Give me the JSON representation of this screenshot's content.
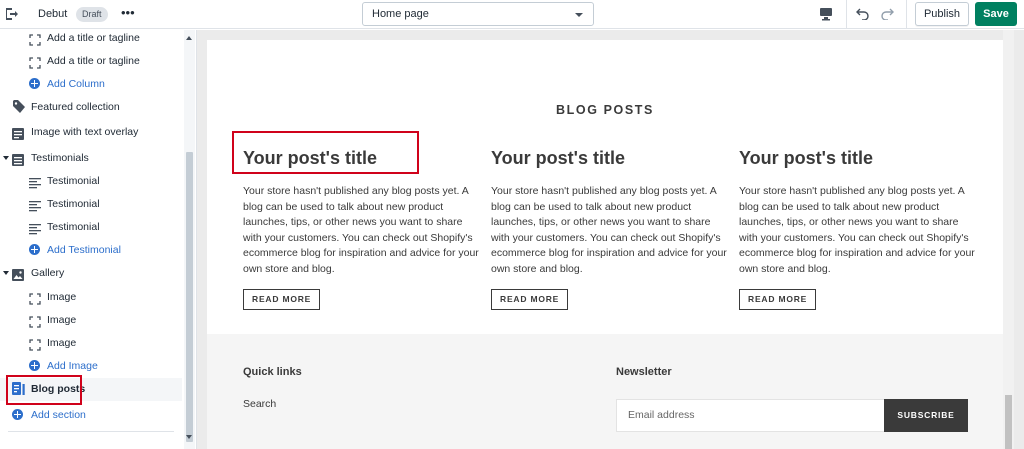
{
  "topbar": {
    "theme_name": "Debut",
    "status_badge": "Draft",
    "more_label": "•••",
    "page_select": "Home page",
    "publish_label": "Publish",
    "save_label": "Save"
  },
  "sidebar": {
    "items": [
      {
        "label": "Add a title or tagline",
        "kind": "block",
        "icon": "block-corners-icon"
      },
      {
        "label": "Add a title or tagline",
        "kind": "block",
        "icon": "block-corners-icon"
      },
      {
        "label": "Add Column",
        "kind": "add",
        "icon": "add-circle-icon"
      },
      {
        "label": "Featured collection",
        "kind": "section",
        "icon": "tag-icon"
      },
      {
        "label": "Image with text overlay",
        "kind": "section",
        "icon": "image-text-icon"
      },
      {
        "label": "Testimonials",
        "kind": "section-expanded",
        "icon": "list-icon"
      },
      {
        "label": "Testimonial",
        "kind": "block",
        "icon": "text-lines-icon"
      },
      {
        "label": "Testimonial",
        "kind": "block",
        "icon": "text-lines-icon"
      },
      {
        "label": "Testimonial",
        "kind": "block",
        "icon": "text-lines-icon"
      },
      {
        "label": "Add Testimonial",
        "kind": "add",
        "icon": "add-circle-icon"
      },
      {
        "label": "Gallery",
        "kind": "section-expanded",
        "icon": "image-icon"
      },
      {
        "label": "Image",
        "kind": "block",
        "icon": "block-corners-icon"
      },
      {
        "label": "Image",
        "kind": "block",
        "icon": "block-corners-icon"
      },
      {
        "label": "Image",
        "kind": "block",
        "icon": "block-corners-icon"
      },
      {
        "label": "Add Image",
        "kind": "add",
        "icon": "add-circle-icon"
      },
      {
        "label": "Blog posts",
        "kind": "section-active",
        "icon": "blog-icon"
      }
    ],
    "add_section_label": "Add section"
  },
  "preview": {
    "blog_heading": "BLOG POSTS",
    "posts": [
      {
        "title": "Your post's title",
        "body": "Your store hasn't published any blog posts yet. A blog can be used to talk about new product launches, tips, or other news you want to share with your customers. You can check out Shopify's ecommerce blog for inspiration and advice for your own store and blog.",
        "button": "READ MORE"
      },
      {
        "title": "Your post's title",
        "body": "Your store hasn't published any blog posts yet. A blog can be used to talk about new product launches, tips, or other news you want to share with your customers. You can check out Shopify's ecommerce blog for inspiration and advice for your own store and blog.",
        "button": "READ MORE"
      },
      {
        "title": "Your post's title",
        "body": "Your store hasn't published any blog posts yet. A blog can be used to talk about new product launches, tips, or other news you want to share with your customers. You can check out Shopify's ecommerce blog for inspiration and advice for your own store and blog.",
        "button": "READ MORE"
      }
    ],
    "footer": {
      "quick_links_heading": "Quick links",
      "quick_links": [
        "Search"
      ],
      "newsletter_heading": "Newsletter",
      "email_placeholder": "Email address",
      "subscribe_label": "SUBSCRIBE"
    }
  },
  "colors": {
    "save_button": "#008060",
    "link_blue": "#2c6ecb",
    "annotation_red": "#d0021b",
    "subscribe_button": "#3a3a3a"
  }
}
